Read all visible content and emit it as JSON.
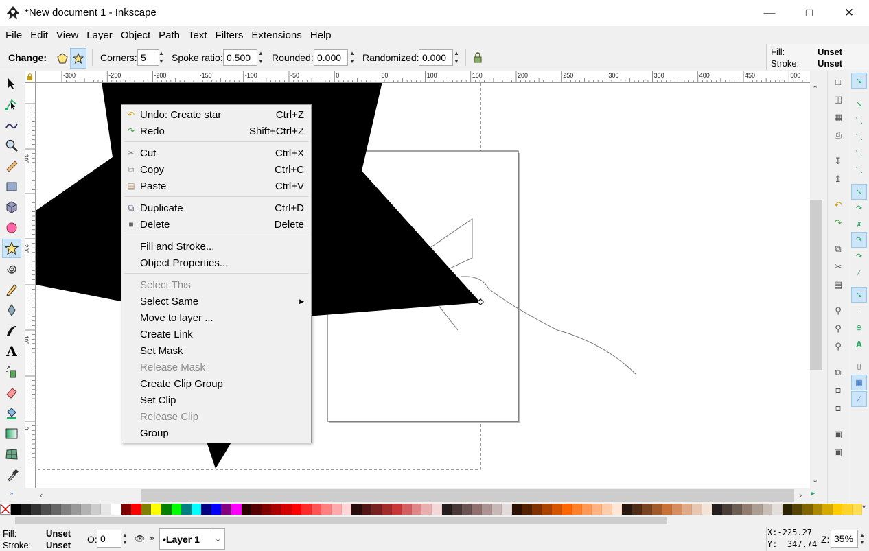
{
  "window": {
    "title": "*New document 1 - Inkscape",
    "minimize_icon": "minimize-icon",
    "maximize_icon": "maximize-icon",
    "close_icon": "close-icon"
  },
  "menubar": [
    "File",
    "Edit",
    "View",
    "Layer",
    "Object",
    "Path",
    "Text",
    "Filters",
    "Extensions",
    "Help"
  ],
  "tool_controls": {
    "change_label": "Change:",
    "corners_label": "Corners:",
    "corners_value": "5",
    "spoke_label": "Spoke ratio:",
    "spoke_value": "0.500",
    "rounded_label": "Rounded:",
    "rounded_value": "0.000",
    "randomized_label": "Randomized:",
    "randomized_value": "0.000"
  },
  "style_indicator_top": {
    "fill_label": "Fill:",
    "fill_value": "Unset",
    "stroke_label": "Stroke:",
    "stroke_value": "Unset"
  },
  "rulers": {
    "horizontal": [
      "-300",
      "-250",
      "-200",
      "-150",
      "-100",
      "-50",
      "0",
      "50",
      "100",
      "150",
      "200",
      "250",
      "300",
      "350",
      "400",
      "450",
      "500"
    ],
    "vertical": [
      "300",
      "250",
      "200",
      "150",
      "100",
      "50",
      "0"
    ]
  },
  "context_menu": [
    {
      "label": "Undo: Create star",
      "shortcut": "Ctrl+Z",
      "icon": "undo-icon",
      "disabled": false
    },
    {
      "label": "Redo",
      "shortcut": "Shift+Ctrl+Z",
      "icon": "redo-icon",
      "disabled": false
    },
    {
      "sep": true
    },
    {
      "label": "Cut",
      "shortcut": "Ctrl+X",
      "icon": "cut-icon",
      "disabled": false
    },
    {
      "label": "Copy",
      "shortcut": "Ctrl+C",
      "icon": "copy-icon",
      "disabled": false
    },
    {
      "label": "Paste",
      "shortcut": "Ctrl+V",
      "icon": "paste-icon",
      "disabled": false
    },
    {
      "sep": true
    },
    {
      "label": "Duplicate",
      "shortcut": "Ctrl+D",
      "icon": "duplicate-icon",
      "disabled": false
    },
    {
      "label": "Delete",
      "shortcut": "Delete",
      "icon": "delete-icon",
      "disabled": false
    },
    {
      "sep": true
    },
    {
      "label": "Fill and Stroke...",
      "shortcut": "",
      "icon": "",
      "disabled": false
    },
    {
      "label": "Object Properties...",
      "shortcut": "",
      "icon": "",
      "disabled": false
    },
    {
      "sep": true
    },
    {
      "label": "Select This",
      "shortcut": "",
      "icon": "",
      "disabled": true
    },
    {
      "label": "Select Same",
      "shortcut": "",
      "icon": "",
      "disabled": false,
      "submenu": true
    },
    {
      "label": "Move to layer ...",
      "shortcut": "",
      "icon": "",
      "disabled": false
    },
    {
      "label": "Create Link",
      "shortcut": "",
      "icon": "",
      "disabled": false
    },
    {
      "label": "Set Mask",
      "shortcut": "",
      "icon": "",
      "disabled": false
    },
    {
      "label": "Release Mask",
      "shortcut": "",
      "icon": "",
      "disabled": true
    },
    {
      "label": "Create Clip Group",
      "shortcut": "",
      "icon": "",
      "disabled": false
    },
    {
      "label": "Set Clip",
      "shortcut": "",
      "icon": "",
      "disabled": false
    },
    {
      "label": "Release Clip",
      "shortcut": "",
      "icon": "",
      "disabled": true
    },
    {
      "label": "Group",
      "shortcut": "",
      "icon": "",
      "disabled": false
    }
  ],
  "statusbar": {
    "fill_label": "Fill:",
    "fill_value": "Unset",
    "stroke_label": "Stroke:",
    "stroke_value": "Unset",
    "opacity_label": "O:",
    "opacity_value": "0",
    "layer_name": "•Layer 1",
    "x_coord": "X:-225.27",
    "y_coord": "Y:  347.74",
    "zoom_label": "Z:",
    "zoom_value": "35%"
  },
  "palette": [
    "#000000",
    "#1a1a1a",
    "#333333",
    "#4d4d4d",
    "#666666",
    "#808080",
    "#999999",
    "#b3b3b3",
    "#cccccc",
    "#e6e6e6",
    "#ffffff",
    "#800000",
    "#ff0000",
    "#808000",
    "#ffff00",
    "#008000",
    "#00ff00",
    "#008080",
    "#00ffff",
    "#000080",
    "#0000ff",
    "#800080",
    "#ff00ff",
    "#2b0000",
    "#550000",
    "#800000",
    "#aa0000",
    "#d40000",
    "#ff0000",
    "#ff2a2a",
    "#ff5555",
    "#ff8080",
    "#ffaaaa",
    "#ffd5d5",
    "#280b0b",
    "#501616",
    "#782121",
    "#a02c2c",
    "#c83737",
    "#d35f5f",
    "#de8787",
    "#e9afaf",
    "#f4d7d7",
    "#241c1c",
    "#483737",
    "#6c5353",
    "#916f6f",
    "#ac9393",
    "#c8b7b7",
    "#e3dbdb",
    "#2b1100",
    "#552200",
    "#803300",
    "#aa4400",
    "#d45500",
    "#ff6600",
    "#ff7f2a",
    "#ff9955",
    "#ffb380",
    "#ffccaa",
    "#ffe6d5",
    "#28170b",
    "#502d16",
    "#784421",
    "#a05a2c",
    "#c87137",
    "#d38d5f",
    "#deaa87",
    "#e9c6af",
    "#f4e3d7",
    "#241f1c",
    "#483e37",
    "#6c5d53",
    "#917c6f",
    "#ac9d93",
    "#c8beb7",
    "#e3dedb",
    "#2b2200",
    "#554400",
    "#806600",
    "#aa8800",
    "#d4aa00",
    "#ffcc00",
    "#ffd42a",
    "#ffdd55"
  ]
}
